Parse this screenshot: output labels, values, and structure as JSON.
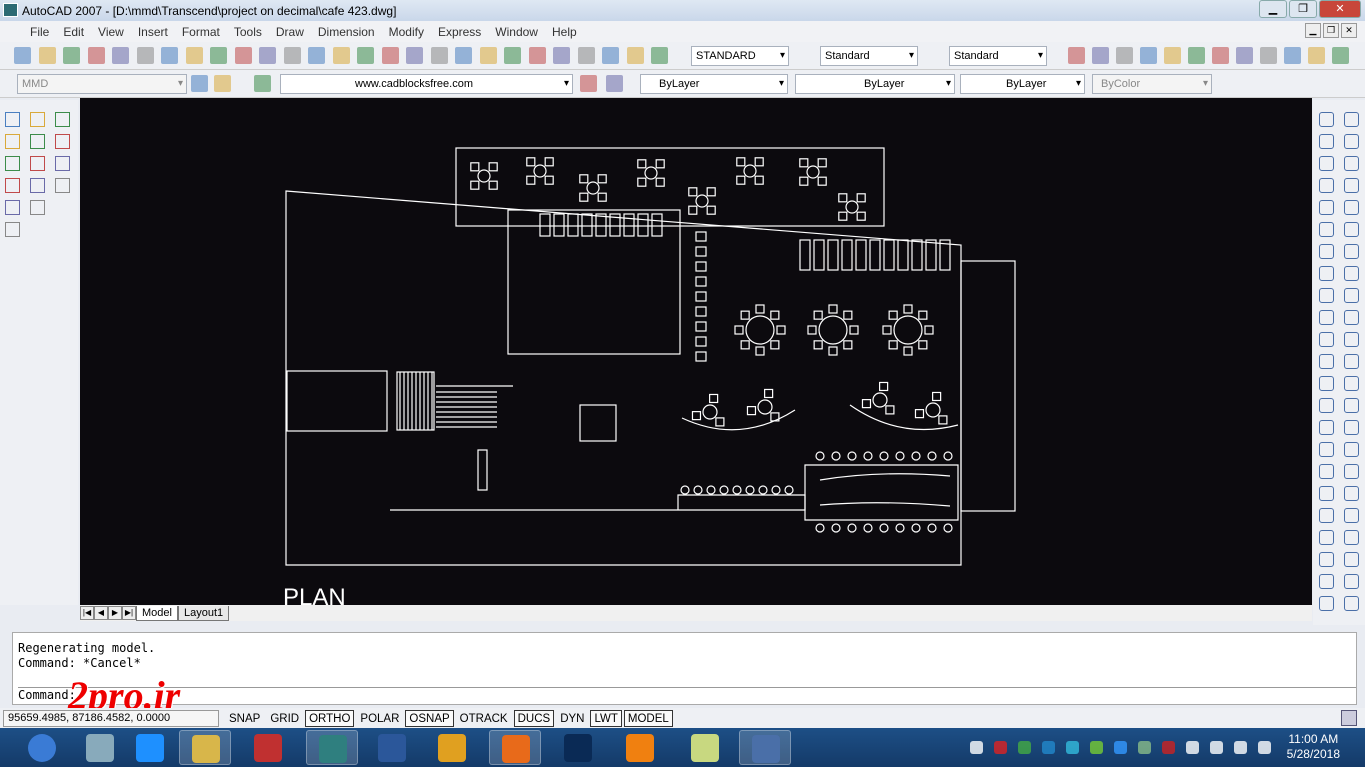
{
  "window": {
    "title": "AutoCAD 2007 - [D:\\mmd\\Transcend\\project on decimal\\cafe 423.dwg]",
    "min": "▁",
    "max": "❐",
    "close": "✕"
  },
  "menu": [
    "File",
    "Edit",
    "View",
    "Insert",
    "Format",
    "Tools",
    "Draw",
    "Dimension",
    "Modify",
    "Express",
    "Window",
    "Help"
  ],
  "toolbar": {
    "text_style": "STANDARD",
    "dim_style": "Standard",
    "table_style": "Standard",
    "workspace": "MMD",
    "layer": "www.cadblocksfree.com",
    "color": "ByLayer",
    "linetype": "ByLayer",
    "lineweight": "ByLayer",
    "plotstyle": "ByColor"
  },
  "drawing": {
    "plan_label": "PLAN"
  },
  "tabs": [
    "Model",
    "Layout1"
  ],
  "command": {
    "lines": [
      "Regenerating model.",
      "Command: *Cancel*"
    ],
    "prompt": "Command:"
  },
  "status": {
    "coords": "95659.4985, 87186.4582, 0.0000",
    "buttons": [
      {
        "label": "SNAP",
        "on": false
      },
      {
        "label": "GRID",
        "on": false
      },
      {
        "label": "ORTHO",
        "on": true
      },
      {
        "label": "POLAR",
        "on": false
      },
      {
        "label": "OSNAP",
        "on": true
      },
      {
        "label": "OTRACK",
        "on": false
      },
      {
        "label": "DUCS",
        "on": true
      },
      {
        "label": "DYN",
        "on": false
      },
      {
        "label": "LWT",
        "on": true
      },
      {
        "label": "MODEL",
        "on": true
      }
    ]
  },
  "watermark": "2pro.ir",
  "taskbar": {
    "apps": [
      "start",
      "calculator",
      "internet-explorer",
      "file-explorer",
      "autocad",
      "autocad-2007",
      "word",
      "chrome",
      "firefox",
      "photoshop",
      "vlc",
      "notes",
      "network"
    ],
    "time": "11:00 AM",
    "date": "5/28/2018"
  }
}
